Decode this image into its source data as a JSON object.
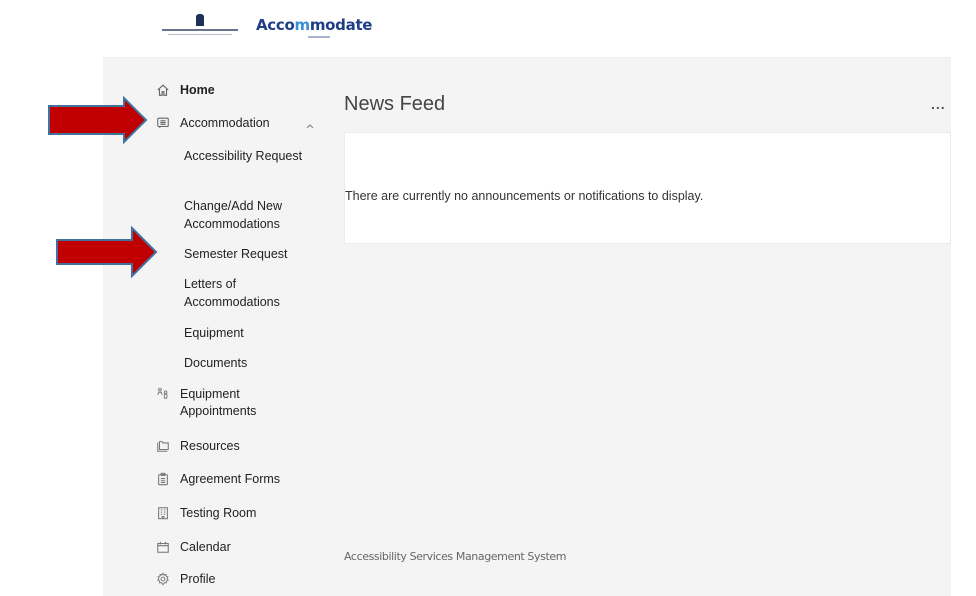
{
  "header": {
    "university_logo_alt": "University crest",
    "brand_name_part1": "Acco",
    "brand_name_accent": "m",
    "brand_name_part2": "modate"
  },
  "sidebar": {
    "items": [
      {
        "label": "Home",
        "icon": "home-icon"
      },
      {
        "label": "Accommodation",
        "icon": "list-chat-icon",
        "expanded": true,
        "children": [
          {
            "label": "Accessibility Request"
          },
          {
            "label": "Change/Add New Accommodations"
          },
          {
            "label": "Semester Request"
          },
          {
            "label": "Letters of Accommodations"
          },
          {
            "label": "Equipment"
          },
          {
            "label": "Documents"
          }
        ]
      },
      {
        "label": "Equipment Appointments",
        "icon": "people-icon"
      },
      {
        "label": "Resources",
        "icon": "folder-icon"
      },
      {
        "label": "Agreement Forms",
        "icon": "clipboard-icon"
      },
      {
        "label": "Testing Room",
        "icon": "building-icon"
      },
      {
        "label": "Calendar",
        "icon": "calendar-icon"
      },
      {
        "label": "Profile",
        "icon": "gear-icon"
      }
    ]
  },
  "main": {
    "title": "News Feed",
    "more_label": "...",
    "empty_message": "There are currently no announcements or notifications to display.",
    "footer": "Accessibility Services Management System"
  },
  "annotations": {
    "arrow_color": "#c00000",
    "arrow_border": "#41719c",
    "targets": [
      "Accommodation",
      "Semester Request"
    ]
  }
}
